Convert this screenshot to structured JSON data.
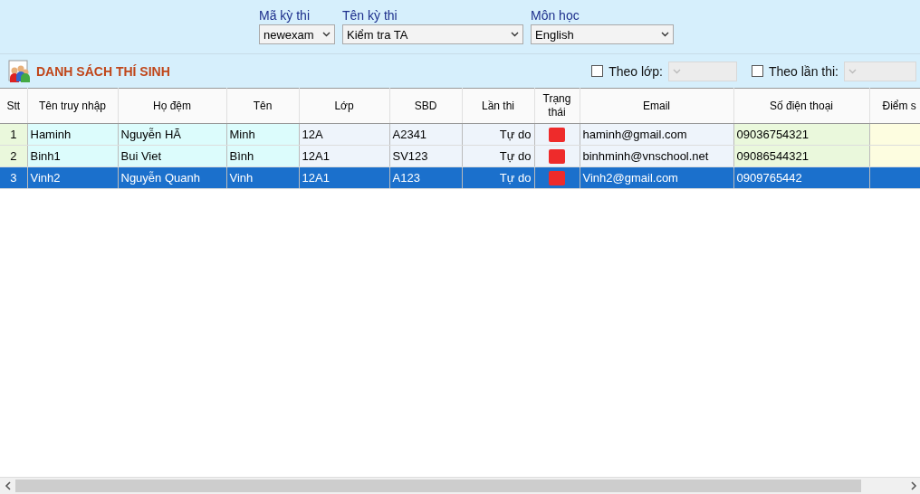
{
  "filters": [
    {
      "label": "Mã kỳ thi",
      "value": "newexam"
    },
    {
      "label": "Tên kỳ thi",
      "value": "Kiểm tra TA"
    },
    {
      "label": "Môn học",
      "value": "English"
    }
  ],
  "list_title": "DANH SÁCH THÍ SINH",
  "options": [
    {
      "label": "Theo lớp:",
      "checked": false,
      "disabled": true
    },
    {
      "label": "Theo lần thi:",
      "checked": false,
      "disabled": true
    }
  ],
  "table": {
    "columns": [
      "Stt",
      "Tên truy nhập",
      "Họ đệm",
      "Tên",
      "Lớp",
      "SBD",
      "Lần thi",
      "Trạng thái",
      "Email",
      "Số điện thoại",
      "Điểm s"
    ],
    "rows": [
      {
        "selected": false,
        "cells": [
          "1",
          "Haminh",
          "Nguyễn HÃ",
          "Minh",
          "12A",
          "A2341",
          "Tự do",
          {
            "color": "#ee2b2b"
          },
          "haminh@gmail.com",
          "09036754321"
        ]
      },
      {
        "selected": false,
        "cells": [
          "2",
          "Binh1",
          "Bui Viet",
          "Bình",
          "12A1",
          "SV123",
          "Tự do",
          {
            "color": "#ee2b2b"
          },
          "binhminh@vnschool.net",
          "09086544321"
        ]
      },
      {
        "selected": true,
        "cells": [
          "3",
          "Vinh2",
          "Nguyễn Quanh",
          "Vinh",
          "12A1",
          "A123",
          "Tự do",
          {
            "color": "#ee2b2b"
          },
          "Vinh2@gmail.com",
          "0909765442"
        ]
      }
    ]
  }
}
